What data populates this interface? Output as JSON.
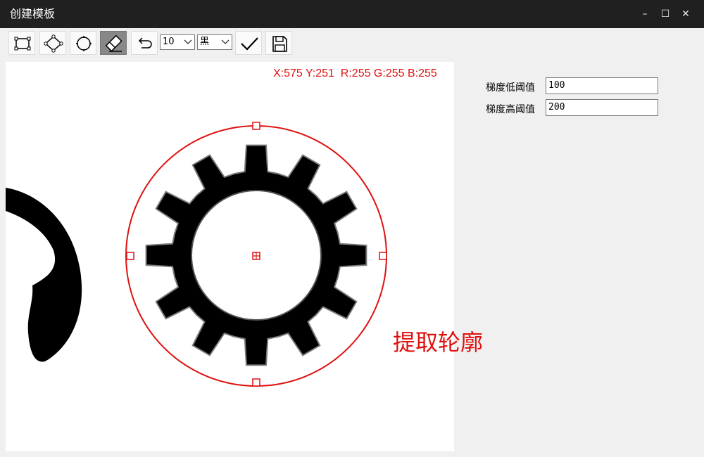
{
  "window": {
    "title": "创建模板",
    "minimize_glyph": "–",
    "maximize_glyph": "☐",
    "close_glyph": "✕"
  },
  "toolbar": {
    "tools": [
      {
        "name": "rectangle-tool",
        "icon": "rectangle-icon"
      },
      {
        "name": "rotated-rect-tool",
        "icon": "rotated-rectangle-icon"
      },
      {
        "name": "circle-tool",
        "icon": "circle-icon"
      },
      {
        "name": "eraser-tool",
        "icon": "eraser-icon",
        "active": true
      },
      {
        "name": "undo-tool",
        "icon": "undo-icon"
      }
    ],
    "brush_size": "10",
    "brush_color": "黑",
    "confirm_icon": "checkmark-icon",
    "save_icon": "save-icon"
  },
  "canvas": {
    "pixel_readout": "X:575 Y:251  R:255 G:255 B:255",
    "overlay_label": "提取轮廓",
    "selection_color": "#e01010"
  },
  "params": {
    "low_threshold_label": "梯度低阈值",
    "low_threshold_value": "100",
    "high_threshold_label": "梯度高阈值",
    "high_threshold_value": "200"
  }
}
